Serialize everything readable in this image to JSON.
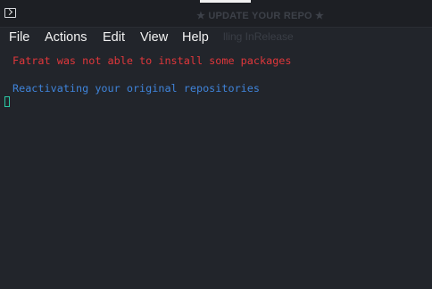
{
  "window": {
    "background_color": "#22252b",
    "titlebar_color": "#1d1f24",
    "faint_title": "★ UPDATE YOUR REPO ★",
    "faint_menu_text": "lling InRelease"
  },
  "menubar": {
    "items": [
      {
        "label": "File"
      },
      {
        "label": "Actions"
      },
      {
        "label": "Edit"
      },
      {
        "label": "View"
      },
      {
        "label": "Help"
      }
    ]
  },
  "terminal": {
    "lines": [
      {
        "text": "Fatrat was not able to install some packages",
        "color": "#e0373b"
      },
      {
        "text": "Reactivating your original repositories",
        "color": "#3f83d9"
      }
    ],
    "cursor_color": "#2bc8a4"
  },
  "icons": {
    "app": "terminal-icon"
  }
}
